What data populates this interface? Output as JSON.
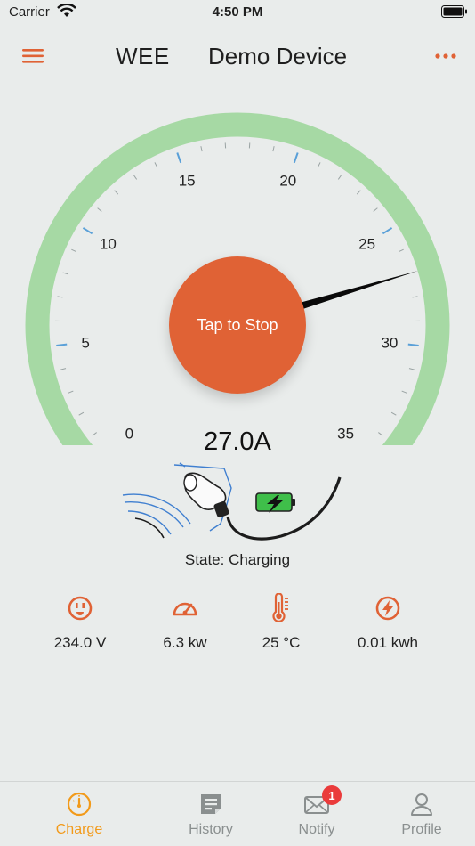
{
  "status_bar": {
    "carrier": "Carrier",
    "time": "4:50 PM",
    "wifi_icon": "wifi-icon",
    "battery_icon": "battery-icon"
  },
  "nav": {
    "menu_icon": "hamburger-menu-icon",
    "app_name": "WEE",
    "device_name": "Demo Device",
    "more_icon": "more-dots-icon",
    "accent_color": "#e06235"
  },
  "gauge": {
    "tick_labels": [
      "0",
      "5",
      "10",
      "15",
      "20",
      "25",
      "30",
      "35"
    ],
    "min": 0,
    "max": 35,
    "value": 27.0,
    "arc_color": "#a6d9a4",
    "tick_color": "#5aa0d8"
  },
  "stop_button": {
    "label": "Tap to Stop",
    "color": "#e06235"
  },
  "current": {
    "display": "27.0A"
  },
  "state": {
    "text": "State: Charging"
  },
  "metrics": [
    {
      "icon": "outlet-icon",
      "value": "234.0 V"
    },
    {
      "icon": "speedometer-icon",
      "value": "6.3 kw"
    },
    {
      "icon": "thermometer-icon",
      "value": "25 °C"
    },
    {
      "icon": "lightning-icon",
      "value": "0.01 kwh"
    }
  ],
  "tabs": [
    {
      "label": "Charge",
      "icon": "charge-gauge-icon",
      "active": true
    },
    {
      "label": "History",
      "icon": "history-note-icon",
      "active": false
    },
    {
      "label": "Notify",
      "icon": "mail-icon",
      "active": false,
      "badge": "1"
    },
    {
      "label": "Profile",
      "icon": "person-icon",
      "active": false
    }
  ],
  "colors": {
    "active_tab": "#f29a1a",
    "inactive_tab": "#8a8f8f",
    "badge": "#ea3b3b"
  }
}
